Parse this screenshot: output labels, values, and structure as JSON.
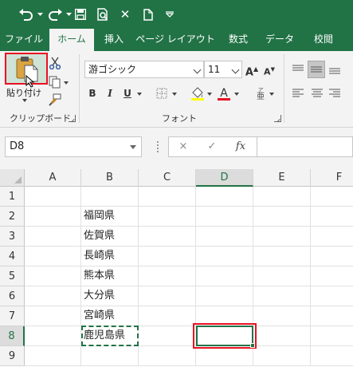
{
  "theme": {
    "accent": "#217346",
    "active_cell_border": "#e81123",
    "copy_marquee": "#217346"
  },
  "qat": {
    "undo_icon": "undo-icon",
    "redo_icon": "redo-icon",
    "save_icon": "save-icon",
    "preview_icon": "print-preview-icon",
    "close_icon": "close-icon",
    "new_icon": "new-document-icon",
    "customize_icon": "customize-qat-icon"
  },
  "tabs": [
    {
      "label": "ファイル"
    },
    {
      "label": "ホーム",
      "active": true
    },
    {
      "label": "挿入"
    },
    {
      "label": "ページ レイアウト"
    },
    {
      "label": "数式"
    },
    {
      "label": "データ"
    },
    {
      "label": "校閲"
    }
  ],
  "clipboard": {
    "paste_label": "貼り付け",
    "group_label": "クリップボード"
  },
  "font": {
    "name": "游ゴシック",
    "size": "11",
    "group_label": "フォント"
  },
  "formula_bar": {
    "name_box": "D8",
    "cancel": "×",
    "enter": "✓",
    "fx": "fx",
    "value": ""
  },
  "columns": [
    "A",
    "B",
    "C",
    "D",
    "E",
    "F"
  ],
  "rows": [
    "1",
    "2",
    "3",
    "4",
    "5",
    "6",
    "7",
    "8",
    "9"
  ],
  "cells": {
    "B2": "福岡県",
    "B3": "佐賀県",
    "B4": "長崎県",
    "B5": "熊本県",
    "B6": "大分県",
    "B7": "宮崎県",
    "B8": "鹿児島県"
  },
  "selection": {
    "active_cell": "D8",
    "copy_source": "B8"
  }
}
